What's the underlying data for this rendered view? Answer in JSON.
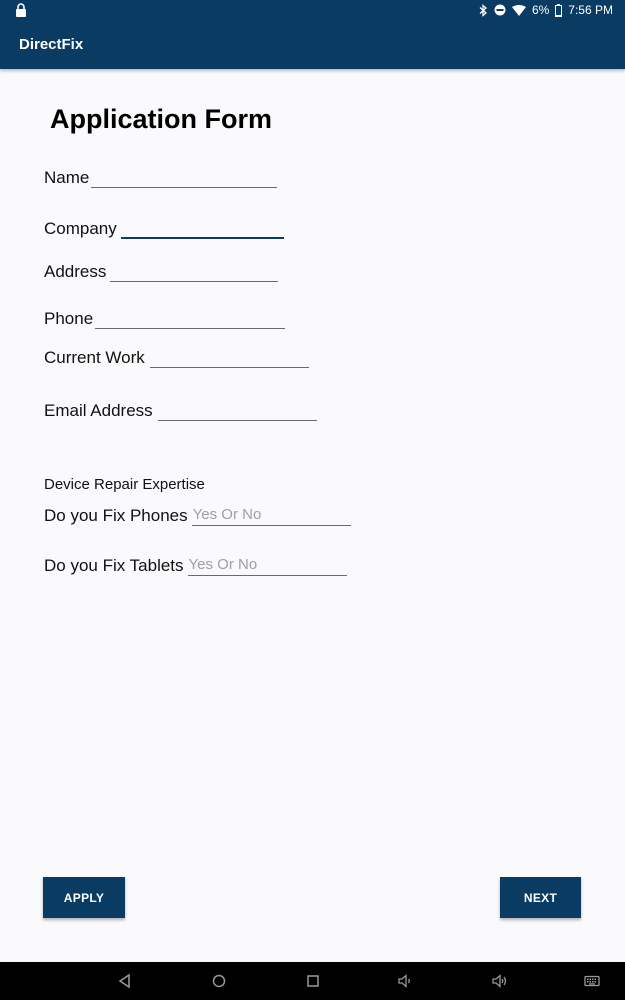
{
  "status_bar": {
    "battery": "6%",
    "time": "7:56 PM"
  },
  "app_bar": {
    "title": "DirectFix"
  },
  "form": {
    "title": "Application Form",
    "fields": {
      "name": {
        "label": "Name"
      },
      "company": {
        "label": "Company"
      },
      "address": {
        "label": "Address"
      },
      "phone": {
        "label": "Phone"
      },
      "current_work": {
        "label": "Current Work"
      },
      "email": {
        "label": "Email Address"
      }
    },
    "section_label": "Device Repair Expertise",
    "fix_phones": {
      "label": "Do you Fix Phones",
      "placeholder": "Yes Or No"
    },
    "fix_tablets": {
      "label": "Do you Fix Tablets",
      "placeholder": "Yes Or No"
    }
  },
  "buttons": {
    "apply": "APPLY",
    "next": "NEXT"
  },
  "nav_icons": [
    "back-icon",
    "home-icon",
    "recents-icon",
    "volume-down-icon",
    "volume-up-icon",
    "keyboard-icon"
  ]
}
